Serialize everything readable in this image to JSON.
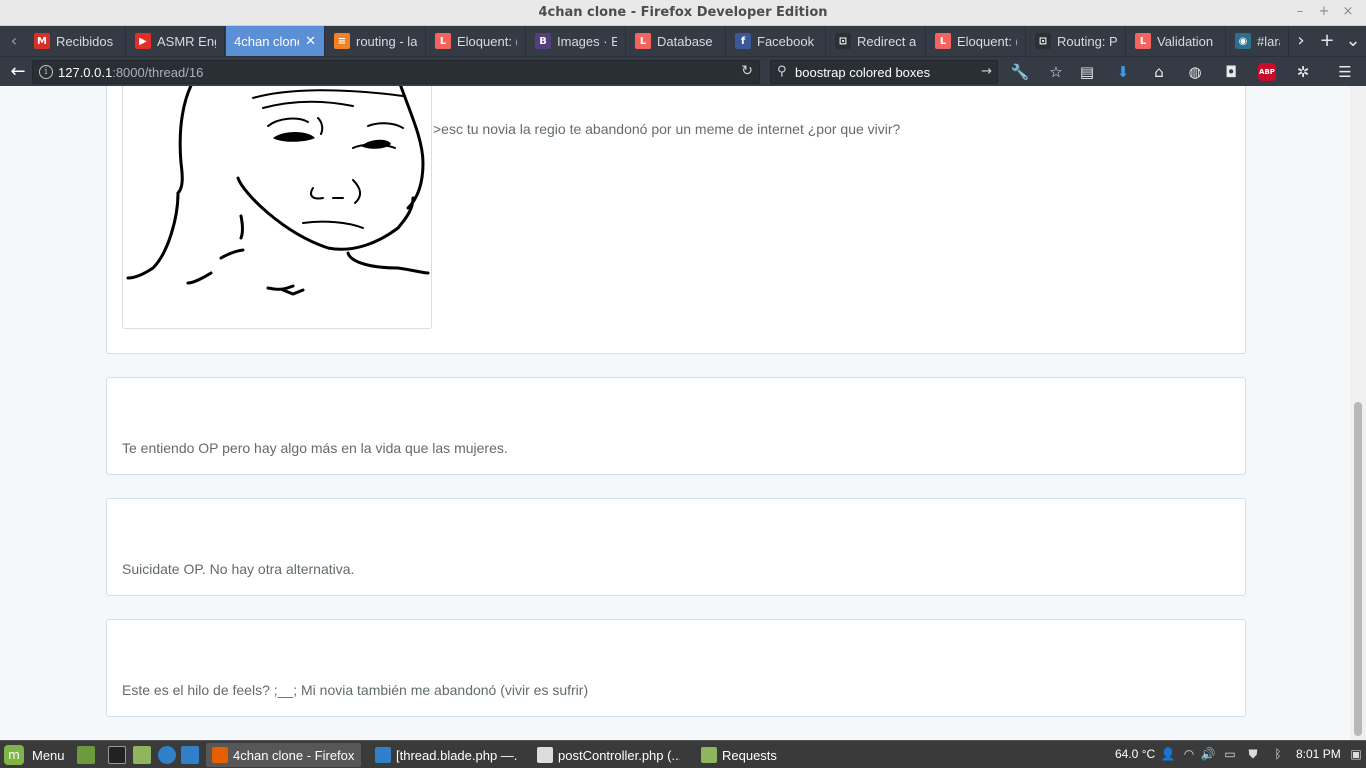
{
  "window": {
    "title": "4chan clone - Firefox Developer Edition",
    "minimize": "–",
    "maximize": "+",
    "close": "×"
  },
  "tabs": [
    {
      "label": "Recibidos",
      "icon": "gmail-icon",
      "color": "#d93025",
      "active": false
    },
    {
      "label": "ASMR Eng",
      "icon": "youtube-icon",
      "color": "#e52d27",
      "active": false
    },
    {
      "label": "4chan clone",
      "icon": "none",
      "color": "",
      "active": true
    },
    {
      "label": "routing - la",
      "icon": "stackoverflow-icon",
      "color": "#f48024",
      "active": false
    },
    {
      "label": "Eloquent: (",
      "icon": "laravel-icon",
      "color": "#f4645f",
      "active": false
    },
    {
      "label": "Images · E",
      "icon": "bootstrap-icon",
      "color": "#563d7c",
      "active": false
    },
    {
      "label": "Database",
      "icon": "laravel-icon",
      "color": "#f4645f",
      "active": false
    },
    {
      "label": "Facebook",
      "icon": "facebook-icon",
      "color": "#3b5998",
      "active": false
    },
    {
      "label": "Redirect a",
      "icon": "laracasts-icon",
      "color": "#2b3035",
      "active": false
    },
    {
      "label": "Eloquent: (",
      "icon": "laravel-icon",
      "color": "#f4645f",
      "active": false
    },
    {
      "label": "Routing: P",
      "icon": "laracasts-icon",
      "color": "#2b3035",
      "active": false
    },
    {
      "label": "Validation",
      "icon": "laravel-icon",
      "color": "#f4645f",
      "active": false
    },
    {
      "label": "#lara",
      "icon": "github-icon",
      "color": "#2e6f8e",
      "active": false
    }
  ],
  "navbar": {
    "url_host": "127.0.0.1",
    "url_rest": ":8000/thread/16",
    "search_query": "boostrap colored boxes"
  },
  "posts": [
    {
      "text": ">esc tu novia la regio te abandonó por un meme de internet ¿por que vivir?"
    },
    {
      "text": "Te entiendo OP pero hay algo más en la vida que las mujeres."
    },
    {
      "text": "Suicidate OP. No hay otra alternativa."
    },
    {
      "text": "Este es el hilo de feels? ;__; Mi novia también me abandonó (vivir es sufrir)"
    }
  ],
  "taskbar": {
    "menu_label": "Menu",
    "tasks": [
      {
        "label": "4chan clone - Firefox...",
        "color": "#e66000",
        "active": true
      },
      {
        "label": "[thread.blade.php —...",
        "color": "#2f80c8",
        "active": false
      },
      {
        "label": "postController.php (...",
        "color": "#dddddd",
        "active": false
      },
      {
        "label": "Requests",
        "color": "#8fb55d",
        "active": false
      }
    ],
    "temperature": "64.0 °C",
    "clock": "8:01 PM"
  }
}
